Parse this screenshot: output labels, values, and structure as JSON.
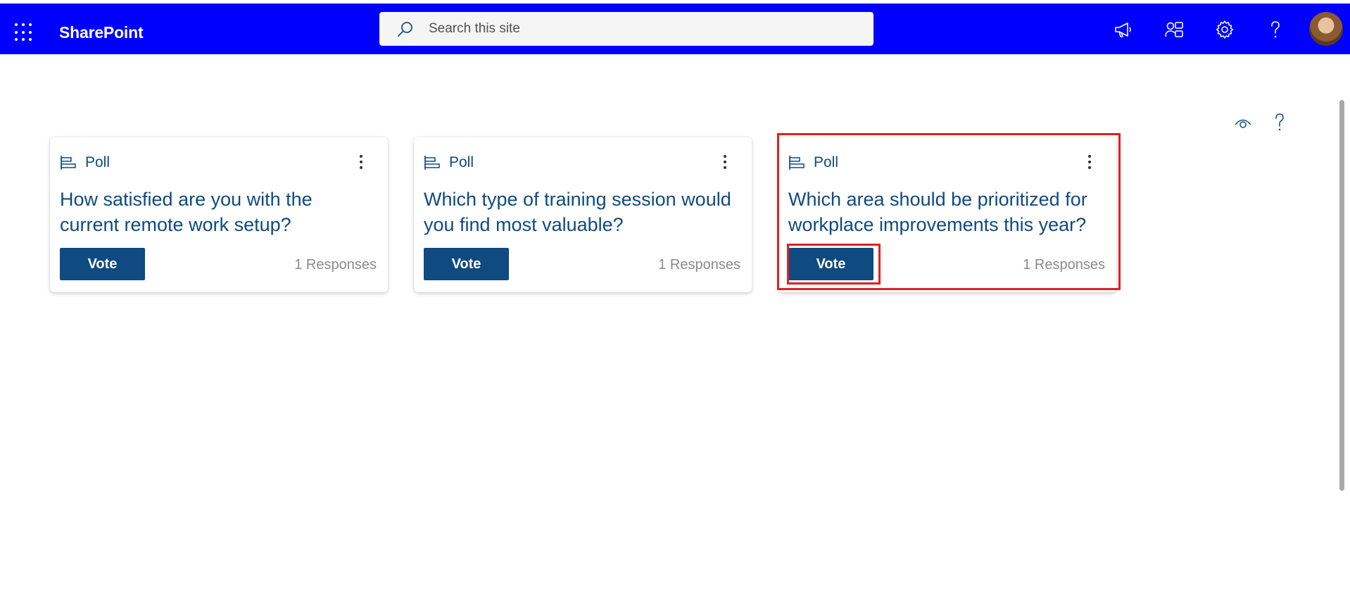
{
  "topbar": {
    "brand": "SharePoint",
    "search_placeholder": "Search this site",
    "icons": [
      "waffle-icon",
      "megaphone-icon",
      "share-icon",
      "gear-icon",
      "help-icon",
      "avatar"
    ],
    "background": "#0000ff"
  },
  "page_tools": {
    "icons": [
      "view-icon",
      "help-icon"
    ]
  },
  "polls": [
    {
      "type_label": "Poll",
      "question": "How satisfied are you with the current remote work setup?",
      "vote_label": "Vote",
      "responses": "1 Responses"
    },
    {
      "type_label": "Poll",
      "question": "Which type of training session would you find most valuable?",
      "vote_label": "Vote",
      "responses": "1 Responses"
    },
    {
      "type_label": "Poll",
      "question": "Which area should be prioritized for workplace improvements this year?",
      "vote_label": "Vote",
      "responses": "1 Responses"
    }
  ],
  "colors": {
    "accent": "#0f4a80",
    "highlight": "#e02020"
  }
}
